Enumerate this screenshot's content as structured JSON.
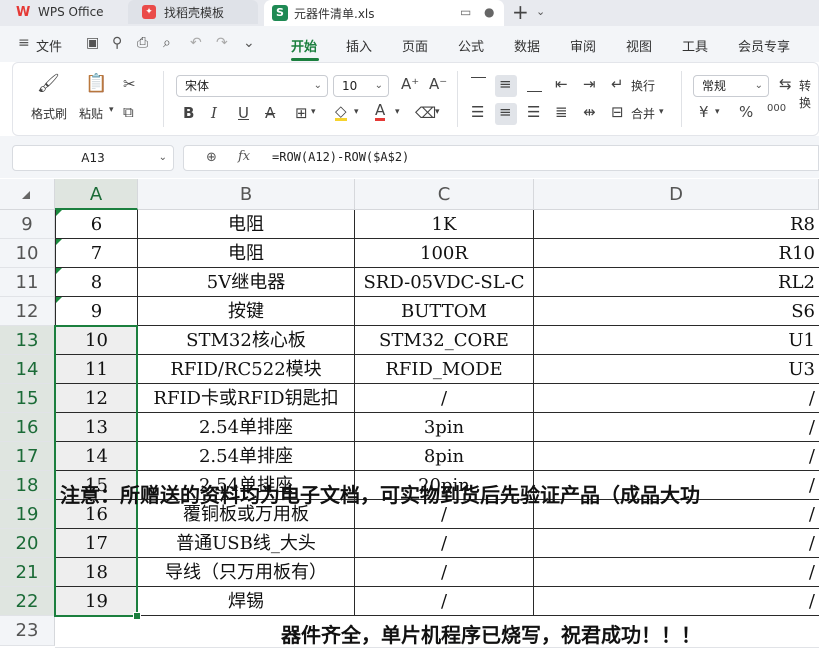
{
  "tabs": {
    "wps": "WPS Office",
    "template": "找稻壳模板",
    "file": "元器件清单.xls",
    "new_tab": "+"
  },
  "menu": {
    "file": "文件",
    "items": [
      "开始",
      "插入",
      "页面",
      "公式",
      "数据",
      "审阅",
      "视图",
      "工具",
      "会员专享"
    ],
    "active": "开始"
  },
  "ribbon": {
    "format_painter": "格式刷",
    "paste": "粘贴",
    "font_name": "宋体",
    "font_size": "10",
    "wrap": "换行",
    "merge": "合并",
    "number_format": "常规",
    "convert": "转换",
    "currency": "¥",
    "percent": "%",
    "thousands": "000"
  },
  "formula_bar": {
    "name_box": "A13",
    "fx": "fx",
    "formula": "=ROW(A12)-ROW($A$2)"
  },
  "columns": [
    "A",
    "B",
    "C",
    "D"
  ],
  "row_numbers": [
    "9",
    "10",
    "11",
    "12",
    "13",
    "14",
    "15",
    "16",
    "17",
    "18",
    "19",
    "20",
    "21",
    "22",
    "23"
  ],
  "rows": [
    {
      "a": "6",
      "b": "电阻",
      "c": "1K",
      "d": "R8"
    },
    {
      "a": "7",
      "b": "电阻",
      "c": "100R",
      "d": "R10"
    },
    {
      "a": "8",
      "b": "5V继电器",
      "c": "SRD-05VDC-SL-C",
      "d": "RL2"
    },
    {
      "a": "9",
      "b": "按键",
      "c": "BUTTOM",
      "d": "S6"
    },
    {
      "a": "10",
      "b": "STM32核心板",
      "c": "STM32_CORE",
      "d": "U1"
    },
    {
      "a": "11",
      "b": "RFID/RC522模块",
      "c": "RFID_MODE",
      "d": "U3"
    },
    {
      "a": "12",
      "b": "RFID卡或RFID钥匙扣",
      "c": "/",
      "d": "/"
    },
    {
      "a": "13",
      "b": "2.54单排座",
      "c": "3pin",
      "d": "/"
    },
    {
      "a": "14",
      "b": "2.54单排座",
      "c": "8pin",
      "d": "/"
    },
    {
      "a": "15",
      "b": "2.54单排座",
      "c": "20pin",
      "d": "/"
    },
    {
      "a": "16",
      "b": "覆铜板或万用板",
      "c": "/",
      "d": "/"
    },
    {
      "a": "17",
      "b": "普通USB线_大头",
      "c": "/",
      "d": "/"
    },
    {
      "a": "18",
      "b": "导线（只万用板有）",
      "c": "/",
      "d": "/"
    },
    {
      "a": "19",
      "b": "焊锡",
      "c": "/",
      "d": "/"
    }
  ],
  "row23_text": "器件齐全，单片机程序已烧写，祝君成功！！！",
  "row24_text": "注意：所赠送的资料均为电子文档，可实物到货后先验证产品（成品大功"
}
